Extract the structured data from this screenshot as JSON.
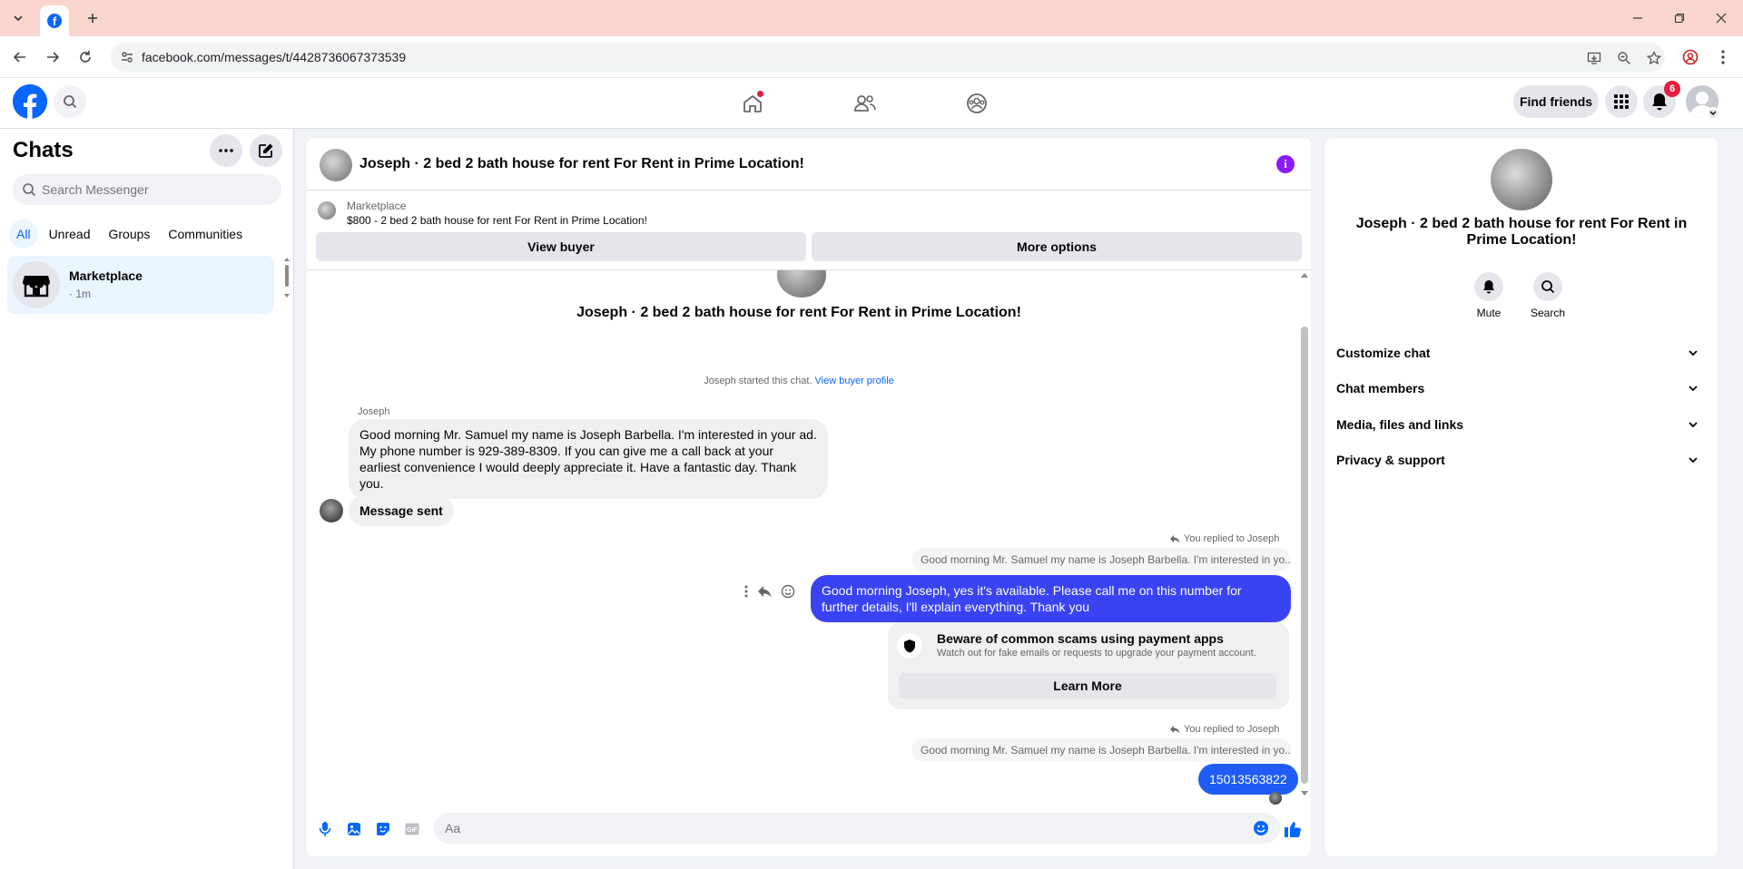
{
  "browser": {
    "url": "facebook.com/messages/t/4428736067373539"
  },
  "header": {
    "find_friends_label": "Find friends",
    "notification_count": "6"
  },
  "sidebar": {
    "title": "Chats",
    "search_placeholder": "Search Messenger",
    "tabs": [
      {
        "label": "All",
        "active": true
      },
      {
        "label": "Unread",
        "active": false
      },
      {
        "label": "Groups",
        "active": false
      },
      {
        "label": "Communities",
        "active": false
      }
    ],
    "chat_items": [
      {
        "name": "Marketplace",
        "time": "· 1m",
        "icon": "marketplace-store-icon"
      }
    ]
  },
  "conversation": {
    "title": "Joseph · 2 bed 2 bath house for rent For Rent in Prime Location!",
    "marketplace": {
      "label": "Marketplace",
      "listing": "$800 - 2 bed 2 bath house for rent For Rent in Prime Location!",
      "view_buyer_label": "View buyer",
      "more_options_label": "More options"
    },
    "thread_name": "Joseph · 2 bed 2 bath house for rent For Rent in Prime Location!",
    "started_text": "Joseph started this chat.",
    "view_buyer_profile": "View buyer profile",
    "sender_name": "Joseph",
    "incoming_message": "Good morning Mr. Samuel my name is Joseph Barbella. I'm interested in your ad. My phone number is 929-389-8309. If you can give me a call back at your earliest convenience I would deeply appreciate it. Have a fantastic day. Thank you.",
    "incoming_message_2": "Message sent",
    "reply_label": "You replied to Joseph",
    "quoted_text": "Good morning Mr. Samuel my name is Joseph Barbella. I'm interested in yo...",
    "outgoing_message": "Good morning Joseph, yes it's available. Please call me on this number for further details, I'll explain everything. Thank you",
    "warning": {
      "title": "Beware of common scams using payment apps",
      "subtitle": "Watch out for fake emails or requests to upgrade your payment account.",
      "button": "Learn More"
    },
    "reply_label_2": "You replied to Joseph",
    "quoted_text_2": "Good morning Mr. Samuel my name is Joseph Barbella. I'm interested in yo...",
    "outgoing_message_2": "15013563822",
    "composer_placeholder": "Aa"
  },
  "info_panel": {
    "name": "Joseph · 2 bed 2 bath house for rent For Rent in Prime Location!",
    "mute_label": "Mute",
    "search_label": "Search",
    "sections": [
      "Customize chat",
      "Chat members",
      "Media, files and links",
      "Privacy & support"
    ]
  },
  "colors": {
    "accent": "#0866ff",
    "outgoing_bubble": "#3a43f2",
    "info_icon": "#8a1cf7",
    "badge": "#e41e3f",
    "tabbar": "#f9d5ce"
  }
}
